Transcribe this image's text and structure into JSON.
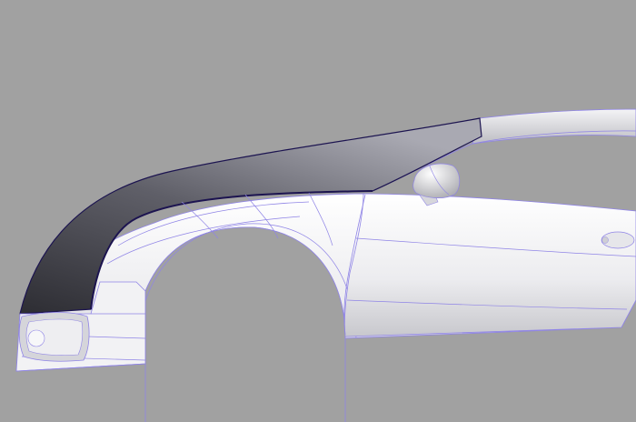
{
  "viewport": {
    "background_color": "#a1a1a1",
    "wire_color": "#8f84e6",
    "edge_color": "#1c1450"
  },
  "model": {
    "fender_colors": [
      "#2d2d33",
      "#6b6b73",
      "#a9a9b2"
    ],
    "body_colors": [
      "#ffffff",
      "#e9e9ec",
      "#c8c8cd"
    ],
    "visible_parts": [
      "front-fender",
      "wheel-arch",
      "hood",
      "a-pillar",
      "roof",
      "side-mirror",
      "door",
      "door-handle",
      "headlight"
    ]
  }
}
